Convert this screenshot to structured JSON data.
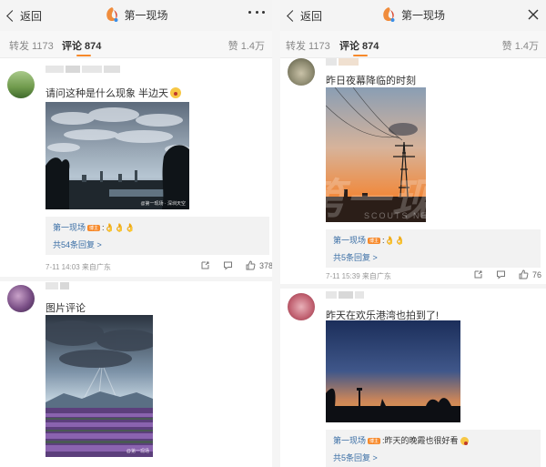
{
  "header": {
    "back_label": "返回",
    "title": "第一现场"
  },
  "tabs": {
    "repost": "转发 1173",
    "comment": "评论 874",
    "like": "赞 1.4万"
  },
  "left": {
    "comments": [
      {
        "text": "请问这种是什么现象  半边天",
        "photo_watermark": "@第一现场 · 深圳天空",
        "reply_name": "第一现场",
        "reply_badge": "博主",
        "reply_text": "👌👌👌",
        "reply_more": "共54条回复 >",
        "time": "7-11 14:03  来自广东",
        "like_count": "378"
      },
      {
        "text": "图片评论",
        "photo_watermark": "@第一现场"
      }
    ]
  },
  "right": {
    "comments": [
      {
        "text": "昨日夜幕降临的时刻",
        "reply_name": "第一现场",
        "reply_badge": "博主",
        "reply_text": "👌👌",
        "reply_more": "共5条回复 >",
        "time": "7-11 15:39  来自广东",
        "like_count": "76"
      },
      {
        "text": "昨天在欢乐港湾也拍到了!",
        "reply_name": "第一现场",
        "reply_badge": "博主",
        "reply_text": "昨天的晚霞也很好看",
        "reply_more": "共5条回复 >"
      }
    ]
  },
  "overlay_watermark": {
    "main": "第一现场",
    "sub": "SCOUTS NEWS"
  },
  "colors": {
    "accent": "#f7892a",
    "link": "#3a6ea5",
    "meta": "#999999"
  }
}
